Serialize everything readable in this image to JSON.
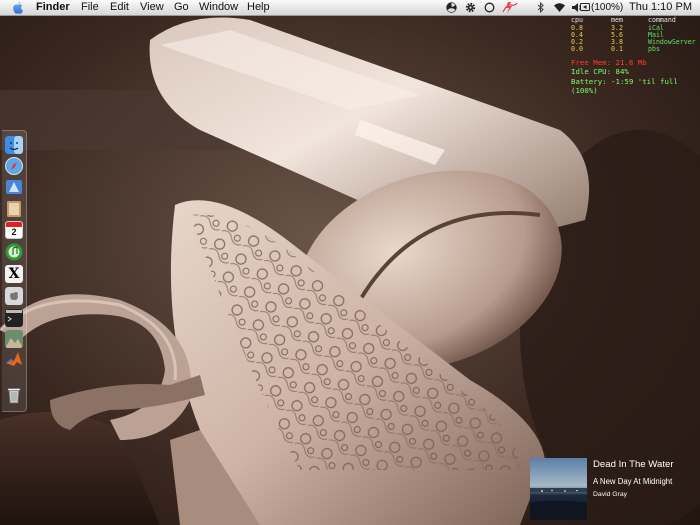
{
  "menubar": {
    "app_name": "Finder",
    "items": [
      "File",
      "Edit",
      "View",
      "Go",
      "Window",
      "Help"
    ],
    "battery_text": "(100%)",
    "clock": "Thu 1:10 PM",
    "status_icons": [
      "radiation-icon",
      "gear-icon",
      "circle-icon",
      "lightning-icon",
      "bluetooth-icon",
      "wifi-icon",
      "volume-icon"
    ]
  },
  "process_monitor": {
    "headers": [
      "cpu",
      "mem",
      "command"
    ],
    "rows": [
      {
        "cpu": "0.8",
        "mem": "3.2",
        "command": "iCal"
      },
      {
        "cpu": "0.4",
        "mem": "5.6",
        "command": "Mail"
      },
      {
        "cpu": "0.2",
        "mem": "3.8",
        "command": "WindowServer"
      },
      {
        "cpu": "0.0",
        "mem": "0.1",
        "command": "pbs"
      }
    ]
  },
  "system_info": {
    "free_mem": "Free Mem: 21.8 Mb",
    "idle_cpu": "Idle CPU: 84%",
    "battery": "Battery: -1:59 'til full (100%)"
  },
  "dock": {
    "icons": [
      "finder-icon",
      "safari-icon",
      "mail-icon",
      "address-book-icon",
      "ical-icon",
      "itunes-icon",
      "x11-icon",
      "apple-icon",
      "terminal-icon",
      "photo-app-icon",
      "matlab-icon",
      "trash-icon"
    ],
    "ical_day": "2",
    "x11_glyph": "X"
  },
  "now_playing": {
    "title": "Dead In The Water",
    "album": "A New Day At Midnight",
    "artist": "David Gray"
  },
  "colors": {
    "stats_header": "#e8e8e8",
    "stats_values": "#e8d23a",
    "free_mem": "#ff3b2f",
    "cpu_battery": "#7cff6a"
  }
}
